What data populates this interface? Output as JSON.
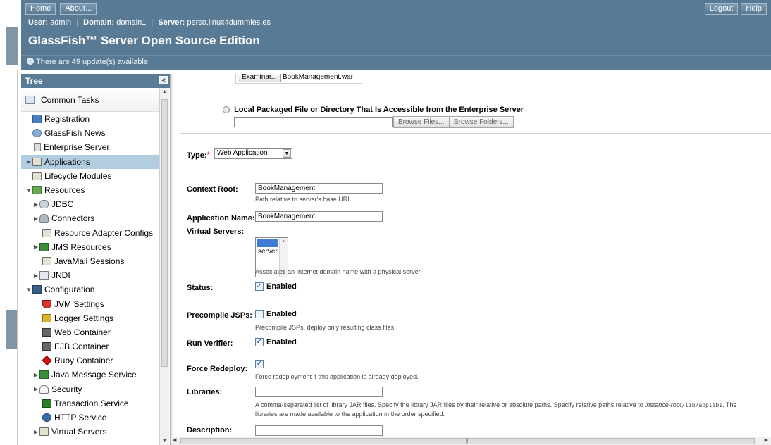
{
  "masthead": {
    "home_label": "Home",
    "about_label": "About...",
    "logout_label": "Logout",
    "help_label": "Help",
    "user_label": "User:",
    "user_value": "admin",
    "domain_label": "Domain:",
    "domain_value": "domain1",
    "server_label": "Server:",
    "server_value": "perso.linux4dummies.es",
    "product_name": "GlassFish™ Server Open Source Edition",
    "update_text": "There are 49 update(s) available."
  },
  "tree": {
    "title": "Tree",
    "collapse_glyph": "<",
    "common_tasks": "Common Tasks",
    "items": [
      {
        "label": "Registration",
        "icon": "registration-icon"
      },
      {
        "label": "GlassFish News",
        "icon": "news-icon"
      },
      {
        "label": "Enterprise Server",
        "icon": "server-icon"
      },
      {
        "label": "Applications",
        "icon": "folder-icon"
      },
      {
        "label": "Lifecycle Modules",
        "icon": "folder-icon"
      },
      {
        "label": "Resources",
        "icon": "resources-icon"
      },
      {
        "label": "JDBC",
        "icon": "database-icon"
      },
      {
        "label": "Connectors",
        "icon": "connector-icon"
      },
      {
        "label": "Resource Adapter Configs",
        "icon": "folder-icon"
      },
      {
        "label": "JMS Resources",
        "icon": "jms-icon"
      },
      {
        "label": "JavaMail Sessions",
        "icon": "folder-icon"
      },
      {
        "label": "JNDI",
        "icon": "jndi-icon"
      },
      {
        "label": "Configuration",
        "icon": "configuration-icon"
      },
      {
        "label": "JVM Settings",
        "icon": "java-icon"
      },
      {
        "label": "Logger Settings",
        "icon": "logger-icon"
      },
      {
        "label": "Web Container",
        "icon": "container-icon"
      },
      {
        "label": "EJB Container",
        "icon": "container-icon"
      },
      {
        "label": "Ruby Container",
        "icon": "ruby-icon"
      },
      {
        "label": "Java Message Service",
        "icon": "jms-icon"
      },
      {
        "label": "Security",
        "icon": "security-icon"
      },
      {
        "label": "Transaction Service",
        "icon": "transaction-icon"
      },
      {
        "label": "HTTP Service",
        "icon": "http-icon"
      },
      {
        "label": "Virtual Servers",
        "icon": "folder-icon"
      }
    ],
    "selected": "Applications"
  },
  "form": {
    "browse_button": "Examinar...",
    "file_name": "BookManagement.war",
    "local_option_label": "Local Packaged File or Directory That Is Accessible from the Enterprise Server",
    "local_path_value": "",
    "browse_files": "Browse Files...",
    "browse_folders": "Browse Folders...",
    "type_label": "Type:",
    "type_value": "Web Application",
    "context_root_label": "Context Root:",
    "context_root_value": "BookManagement",
    "context_root_help": "Path relative to server's base URL",
    "app_name_label": "Application Name:",
    "app_name_value": "BookManagement",
    "virtual_servers_label": "Virtual Servers:",
    "virtual_servers_option": "server",
    "virtual_servers_help": "Associates an Internet domain name with a physical server",
    "status_label": "Status:",
    "enabled_label": "Enabled",
    "precompile_label": "Precompile JSPs:",
    "precompile_help": "Precompile JSPs, deploy only resulting class files",
    "run_verifier_label": "Run Verifier:",
    "force_redeploy_label": "Force Redeploy:",
    "force_redeploy_help": "Force redeployment if this application is already deployed.",
    "libraries_label": "Libraries:",
    "libraries_value": "",
    "libraries_help_1": "A comma-separated list of library JAR files. Specify the library JAR files by their relative or absolute paths. Specify relative paths relative to",
    "libraries_help_em": "instance-root",
    "libraries_help_code": "/lib/applibs",
    "libraries_help_2": ". The",
    "libraries_help_3": "libraries are made available to the application in the order specified.",
    "description_label": "Description:",
    "description_value": ""
  },
  "state": {
    "status_enabled": true,
    "precompile_enabled": false,
    "run_verifier_enabled": true,
    "force_redeploy": true
  }
}
